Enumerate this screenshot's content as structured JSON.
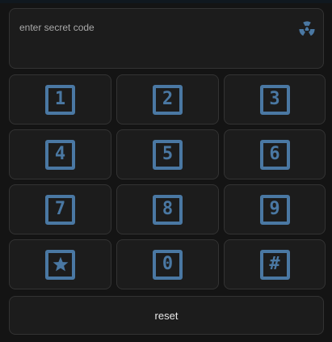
{
  "display": {
    "label": "enter secret code",
    "icon": "radioactive-icon"
  },
  "keypad": {
    "accent_color": "#4a78a3",
    "keys": [
      {
        "label": "1",
        "icon": "numeric-1-box-icon"
      },
      {
        "label": "2",
        "icon": "numeric-2-box-icon"
      },
      {
        "label": "3",
        "icon": "numeric-3-box-icon"
      },
      {
        "label": "4",
        "icon": "numeric-4-box-icon"
      },
      {
        "label": "5",
        "icon": "numeric-5-box-icon"
      },
      {
        "label": "6",
        "icon": "numeric-6-box-icon"
      },
      {
        "label": "7",
        "icon": "numeric-7-box-icon"
      },
      {
        "label": "8",
        "icon": "numeric-8-box-icon"
      },
      {
        "label": "9",
        "icon": "numeric-9-box-icon"
      },
      {
        "label": "",
        "icon": "star-box-icon"
      },
      {
        "label": "0",
        "icon": "numeric-0-box-icon"
      },
      {
        "label": "#",
        "icon": "pound-box-icon"
      }
    ]
  },
  "reset": {
    "label": "reset"
  }
}
